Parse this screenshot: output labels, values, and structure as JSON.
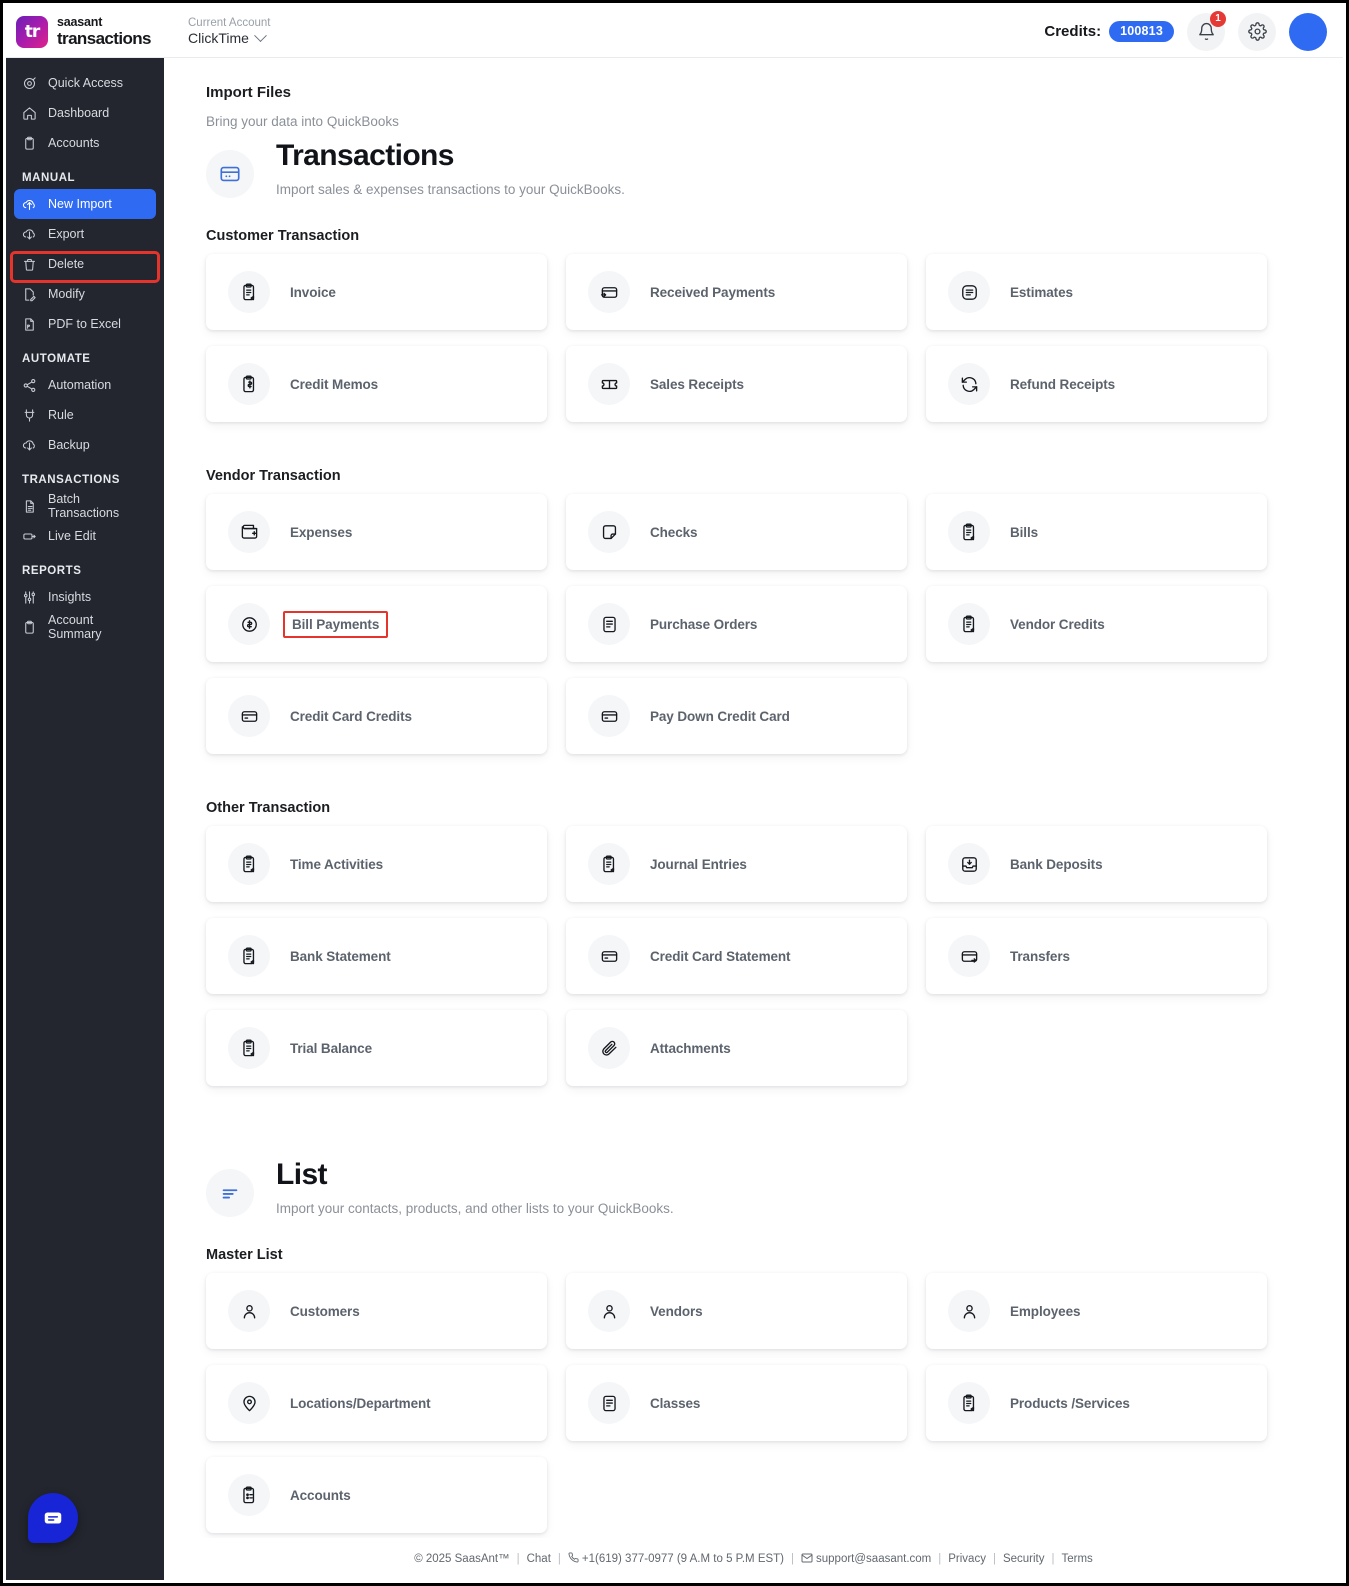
{
  "topbar": {
    "brand_top": "saasant",
    "brand_bottom": "transactions",
    "brand_mark": "tr",
    "account_label": "Current Account",
    "account_value": "ClickTime",
    "credits_label": "Credits:",
    "credits_value": "100813",
    "notification_badge": "1"
  },
  "sidebar": {
    "items": [
      {
        "label": "Quick Access",
        "icon": "target-icon"
      },
      {
        "label": "Dashboard",
        "icon": "home-icon"
      },
      {
        "label": "Accounts",
        "icon": "clipboard-icon"
      }
    ],
    "groups": [
      {
        "title": "MANUAL",
        "items": [
          {
            "label": "New Import",
            "icon": "upload-cloud-icon",
            "selected": true,
            "highlighted": true
          },
          {
            "label": "Export",
            "icon": "download-cloud-icon"
          },
          {
            "label": "Delete",
            "icon": "trash-icon"
          },
          {
            "label": "Modify",
            "icon": "file-edit-icon"
          },
          {
            "label": "PDF to Excel",
            "icon": "pdf-file-icon"
          }
        ]
      },
      {
        "title": "AUTOMATE",
        "items": [
          {
            "label": "Automation",
            "icon": "share-nodes-icon"
          },
          {
            "label": "Rule",
            "icon": "rule-icon"
          },
          {
            "label": "Backup",
            "icon": "download-cloud-icon"
          }
        ]
      },
      {
        "title": "TRANSACTIONS",
        "items": [
          {
            "label": "Batch Transactions",
            "icon": "document-icon"
          },
          {
            "label": "Live Edit",
            "icon": "pencil-line-icon"
          }
        ]
      },
      {
        "title": "REPORTS",
        "items": [
          {
            "label": "Insights",
            "icon": "sliders-icon"
          },
          {
            "label": "Account Summary",
            "icon": "clipboard-icon"
          }
        ]
      }
    ]
  },
  "main": {
    "page_title": "Import Files",
    "page_subtitle": "Bring your data into QuickBooks",
    "transactions_hero": {
      "icon": "credit-card-icon",
      "title": "Transactions",
      "description": "Import sales & expenses transactions to your QuickBooks."
    },
    "list_hero": {
      "icon": "list-lines-icon",
      "title": "List",
      "description": "Import your contacts, products, and other lists to your QuickBooks."
    },
    "sections": [
      {
        "title": "Customer Transaction",
        "cards": [
          {
            "label": "Invoice",
            "icon": "clipboard-text-icon"
          },
          {
            "label": "Received Payments",
            "icon": "card-in-icon"
          },
          {
            "label": "Estimates",
            "icon": "doc-lines-circle-icon"
          },
          {
            "label": "Credit Memos",
            "icon": "clipboard-dollar-icon"
          },
          {
            "label": "Sales Receipts",
            "icon": "ticket-icon"
          },
          {
            "label": "Refund Receipts",
            "icon": "refresh-icon"
          }
        ]
      },
      {
        "title": "Vendor Transaction",
        "cards": [
          {
            "label": "Expenses",
            "icon": "wallet-plus-icon"
          },
          {
            "label": "Checks",
            "icon": "check-note-icon"
          },
          {
            "label": "Bills",
            "icon": "clipboard-text-icon"
          },
          {
            "label": "Bill Payments",
            "icon": "dollar-circle-icon",
            "highlighted": true
          },
          {
            "label": "Purchase Orders",
            "icon": "doc-lines-icon"
          },
          {
            "label": "Vendor Credits",
            "icon": "clipboard-text-icon"
          },
          {
            "label": "Credit Card Credits",
            "icon": "card-icon"
          },
          {
            "label": "Pay Down Credit Card",
            "icon": "card-icon"
          },
          {
            "label": "",
            "icon": "",
            "empty": true
          }
        ]
      },
      {
        "title": "Other Transaction",
        "cards": [
          {
            "label": "Time Activities",
            "icon": "clipboard-text-icon"
          },
          {
            "label": "Journal Entries",
            "icon": "clipboard-text-icon"
          },
          {
            "label": "Bank Deposits",
            "icon": "inbox-down-icon"
          },
          {
            "label": "Bank Statement",
            "icon": "clipboard-text-icon"
          },
          {
            "label": "Credit Card Statement",
            "icon": "card-icon"
          },
          {
            "label": "Transfers",
            "icon": "card-out-icon"
          },
          {
            "label": "Trial Balance",
            "icon": "clipboard-text-icon"
          },
          {
            "label": "Attachments",
            "icon": "paperclip-icon"
          },
          {
            "label": "",
            "icon": "",
            "empty": true
          }
        ]
      }
    ],
    "list_sections": [
      {
        "title": "Master List",
        "cards": [
          {
            "label": "Customers",
            "icon": "user-icon"
          },
          {
            "label": "Vendors",
            "icon": "user-icon"
          },
          {
            "label": "Employees",
            "icon": "user-icon"
          },
          {
            "label": "Locations/Department",
            "icon": "map-pin-icon"
          },
          {
            "label": "Classes",
            "icon": "doc-lines-icon"
          },
          {
            "label": "Products /Services",
            "icon": "clipboard-text-icon"
          },
          {
            "label": "Accounts",
            "icon": "clipboard-dots-icon"
          },
          {
            "label": "",
            "icon": "",
            "empty": true
          },
          {
            "label": "",
            "icon": "",
            "empty": true
          }
        ]
      }
    ]
  },
  "footer": {
    "copyright": "© 2025 SaasAnt™",
    "chat": "Chat",
    "phone": "+1(619) 377-0977 (9 A.M to 5 P.M EST)",
    "email": "support@saasant.com",
    "privacy": "Privacy",
    "security": "Security",
    "terms": "Terms"
  },
  "chat_fab": {
    "icon": "chat-bubble-icon"
  }
}
